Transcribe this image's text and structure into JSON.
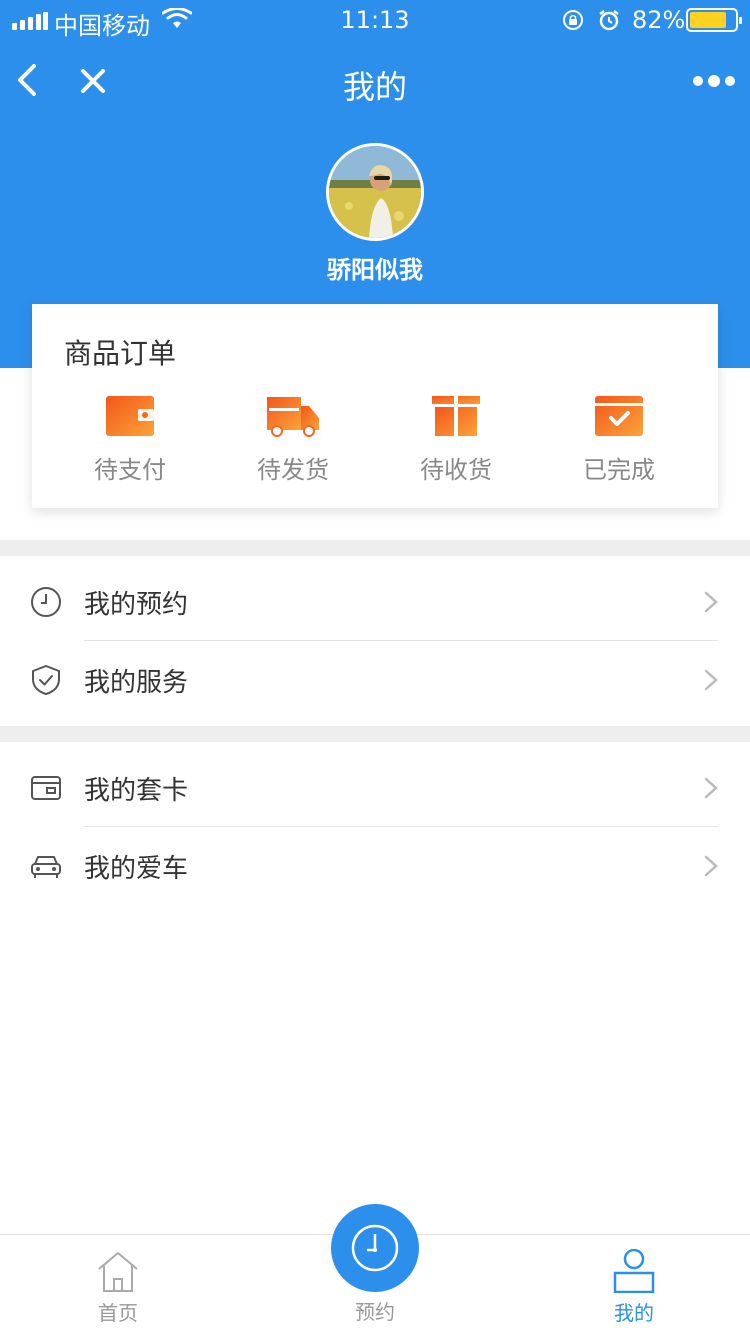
{
  "status_bar": {
    "carrier": "中国移动",
    "time": "11:13",
    "battery_percent_text": "82%",
    "battery_level": 0.82,
    "icons": [
      "signal-icon",
      "wifi-icon",
      "rotation-lock-icon",
      "alarm-icon",
      "battery-icon"
    ]
  },
  "navbar": {
    "title": "我的",
    "icons": [
      "back-icon",
      "close-icon",
      "more-icon"
    ]
  },
  "profile": {
    "username": "骄阳似我"
  },
  "orders": {
    "title": "商品订单",
    "items": [
      {
        "label": "待支付",
        "icon": "wallet-icon"
      },
      {
        "label": "待发货",
        "icon": "truck-icon"
      },
      {
        "label": "待收货",
        "icon": "gift-icon"
      },
      {
        "label": "已完成",
        "icon": "completed-icon"
      }
    ]
  },
  "menu": {
    "group1": [
      {
        "label": "我的预约",
        "icon": "clock-icon"
      },
      {
        "label": "我的服务",
        "icon": "shield-icon"
      }
    ],
    "group2": [
      {
        "label": "我的套卡",
        "icon": "card-icon"
      },
      {
        "label": "我的爱车",
        "icon": "car-icon"
      }
    ]
  },
  "tabbar": {
    "tabs": [
      {
        "label": "首页",
        "icon": "home-icon"
      },
      {
        "label": "预约",
        "icon": "clock-icon"
      },
      {
        "label": "我的",
        "icon": "user-icon"
      }
    ],
    "active": "我的"
  },
  "colors": {
    "primary": "#2d8fec",
    "accent_orange": "#f26a1b",
    "battery": "#ffd21f"
  }
}
